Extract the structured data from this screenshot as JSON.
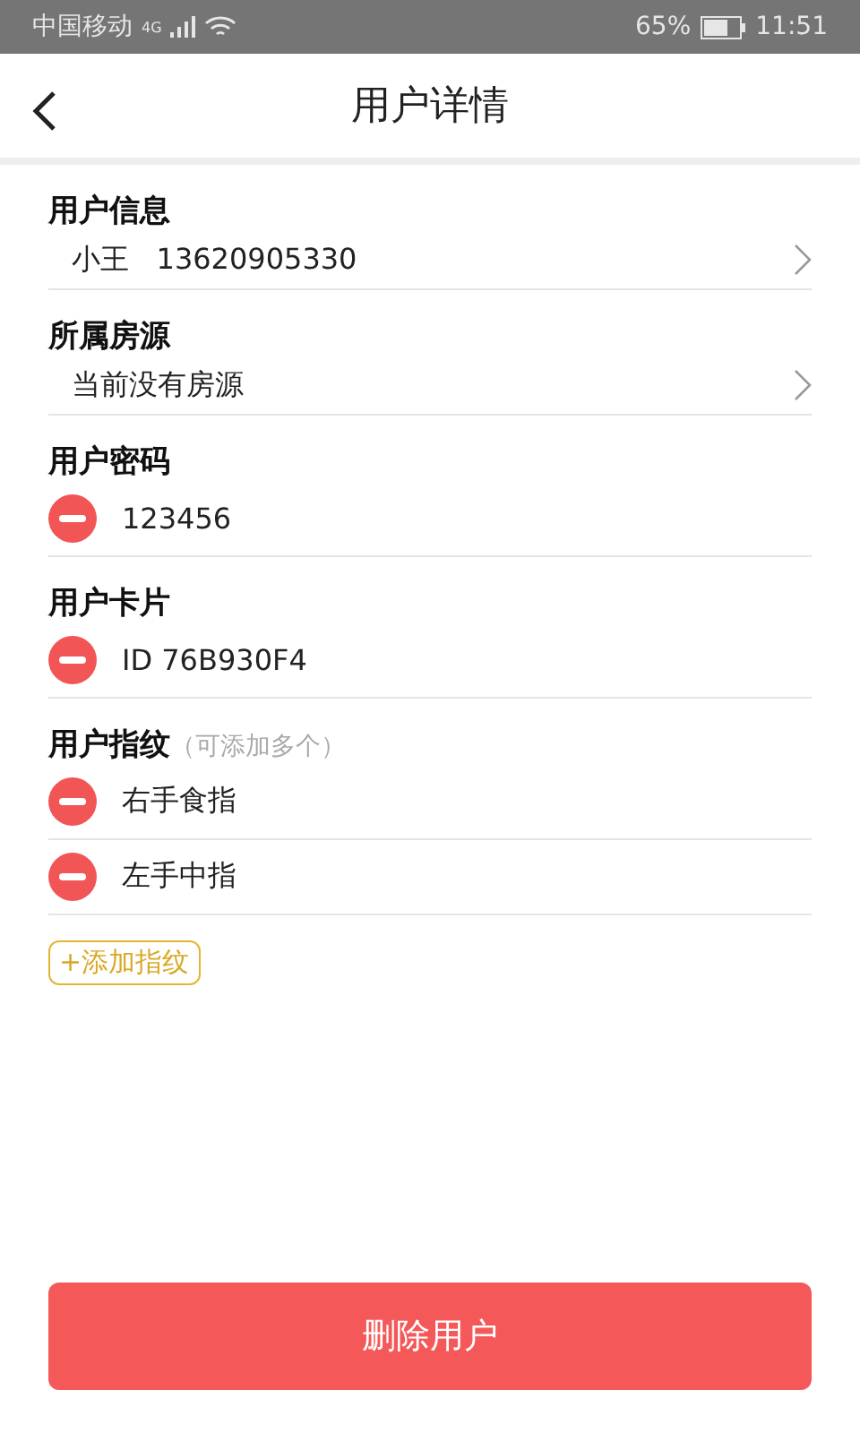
{
  "status_bar": {
    "carrier": "中国移动",
    "network": "4G",
    "battery": "65%",
    "time": "11:51"
  },
  "header": {
    "title": "用户详情"
  },
  "sections": [
    {
      "title": "用户信息",
      "kind": "link",
      "items": [
        "小王   13620905330"
      ]
    },
    {
      "title": "所属房源",
      "kind": "link",
      "items": [
        "当前没有房源"
      ]
    },
    {
      "title": "用户密码",
      "kind": "removable",
      "items": [
        "123456"
      ]
    },
    {
      "title": "用户卡片",
      "kind": "removable",
      "items": [
        "ID 76B930F4"
      ]
    },
    {
      "title": "用户指纹",
      "hint": "（可添加多个）",
      "kind": "removable",
      "items": [
        "右手食指",
        "左手中指"
      ],
      "add_button": "+添加指纹"
    }
  ],
  "delete_button": "删除用户"
}
